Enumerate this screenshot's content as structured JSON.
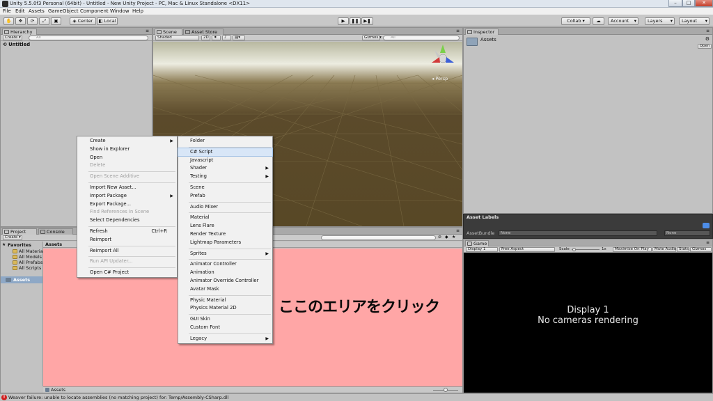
{
  "window": {
    "title": "Unity 5.5.0f3 Personal (64bit) - Untitled - New Unity Project - PC, Mac & Linux Standalone <DX11>",
    "minimize": "–",
    "maximize": "□",
    "close": "✕"
  },
  "menu": [
    "File",
    "Edit",
    "Assets",
    "GameObject",
    "Component",
    "Window",
    "Help"
  ],
  "toolbar": {
    "pivot": "Center",
    "space": "Local",
    "play": "▶",
    "pause": "❚❚",
    "step": "▶❚",
    "collab": "Collab ▾",
    "account": "Account",
    "layers": "Layers",
    "layout": "Layout"
  },
  "hierarchy": {
    "tab": "Hierarchy",
    "create": "Create ▾",
    "search_placeholder": "All",
    "scene": "Untitled"
  },
  "scene_view": {
    "tabs": [
      "Scene",
      "Asset Store"
    ],
    "shading": "Shaded",
    "mode_2d": "2D",
    "gizmos": "Gizmos ▾",
    "search_placeholder": "All",
    "persp": "Persp"
  },
  "inspector": {
    "tab": "Inspector",
    "title": "Assets",
    "open_button": "Open"
  },
  "asset_labels": {
    "title": "Asset Labels",
    "bundle_label": "AssetBundle",
    "bundle_value": "None",
    "variant_value": "None"
  },
  "game": {
    "tab": "Game",
    "display": "Display 1",
    "aspect": "Free Aspect",
    "scale_label": "Scale",
    "scale_value": "1x",
    "maximize": "Maximize On Play",
    "mute": "Mute Audio",
    "stats": "Stats",
    "gizmos": "Gizmos",
    "message_line1": "Display 1",
    "message_line2": "No cameras rendering"
  },
  "project": {
    "tabs": [
      "Project",
      "Console"
    ],
    "create": "Create ▾",
    "favorites_header": "Favorites",
    "favorites": [
      "All Materials",
      "All Models",
      "All Prefabs",
      "All Scripts"
    ],
    "assets_root": "Assets",
    "breadcrumb": "Assets",
    "footer_path": "Assets",
    "annotation": "ここのエリアをクリック"
  },
  "context_menu": {
    "items": [
      {
        "label": "Create",
        "sub": true
      },
      {
        "label": "Show in Explorer"
      },
      {
        "label": "Open"
      },
      {
        "label": "Delete",
        "disabled": true
      },
      {
        "sep": true
      },
      {
        "label": "Open Scene Additive",
        "disabled": true
      },
      {
        "sep": true
      },
      {
        "label": "Import New Asset..."
      },
      {
        "label": "Import Package",
        "sub": true
      },
      {
        "label": "Export Package..."
      },
      {
        "label": "Find References In Scene",
        "disabled": true
      },
      {
        "label": "Select Dependencies"
      },
      {
        "sep": true
      },
      {
        "label": "Refresh",
        "shortcut": "Ctrl+R"
      },
      {
        "label": "Reimport"
      },
      {
        "sep": true
      },
      {
        "label": "Reimport All"
      },
      {
        "sep": true
      },
      {
        "label": "Run API Updater...",
        "disabled": true
      },
      {
        "sep": true
      },
      {
        "label": "Open C# Project"
      }
    ]
  },
  "create_submenu": {
    "items": [
      {
        "label": "Folder"
      },
      {
        "sep": true
      },
      {
        "label": "C# Script",
        "highlight": true
      },
      {
        "label": "Javascript"
      },
      {
        "label": "Shader",
        "sub": true
      },
      {
        "label": "Testing",
        "sub": true
      },
      {
        "sep": true
      },
      {
        "label": "Scene"
      },
      {
        "label": "Prefab"
      },
      {
        "sep": true
      },
      {
        "label": "Audio Mixer"
      },
      {
        "sep": true
      },
      {
        "label": "Material"
      },
      {
        "label": "Lens Flare"
      },
      {
        "label": "Render Texture"
      },
      {
        "label": "Lightmap Parameters"
      },
      {
        "sep": true
      },
      {
        "label": "Sprites",
        "sub": true
      },
      {
        "sep": true
      },
      {
        "label": "Animator Controller"
      },
      {
        "label": "Animation"
      },
      {
        "label": "Animator Override Controller"
      },
      {
        "label": "Avatar Mask"
      },
      {
        "sep": true
      },
      {
        "label": "Physic Material"
      },
      {
        "label": "Physics Material 2D"
      },
      {
        "sep": true
      },
      {
        "label": "GUI Skin"
      },
      {
        "label": "Custom Font"
      },
      {
        "sep": true
      },
      {
        "label": "Legacy",
        "sub": true
      }
    ]
  },
  "status": {
    "message": "Weaver failure: unable to locate assemblies (no matching project) for: Temp/Assembly-CSharp.dll"
  },
  "colors": {
    "project_highlight": "#ffa6a6",
    "scene_ground": "#5b4a2b",
    "scene_sky": "#e8e8c8",
    "game_bg": "#000000",
    "menu_highlight": "#d8e6f7",
    "error": "#d02020"
  }
}
